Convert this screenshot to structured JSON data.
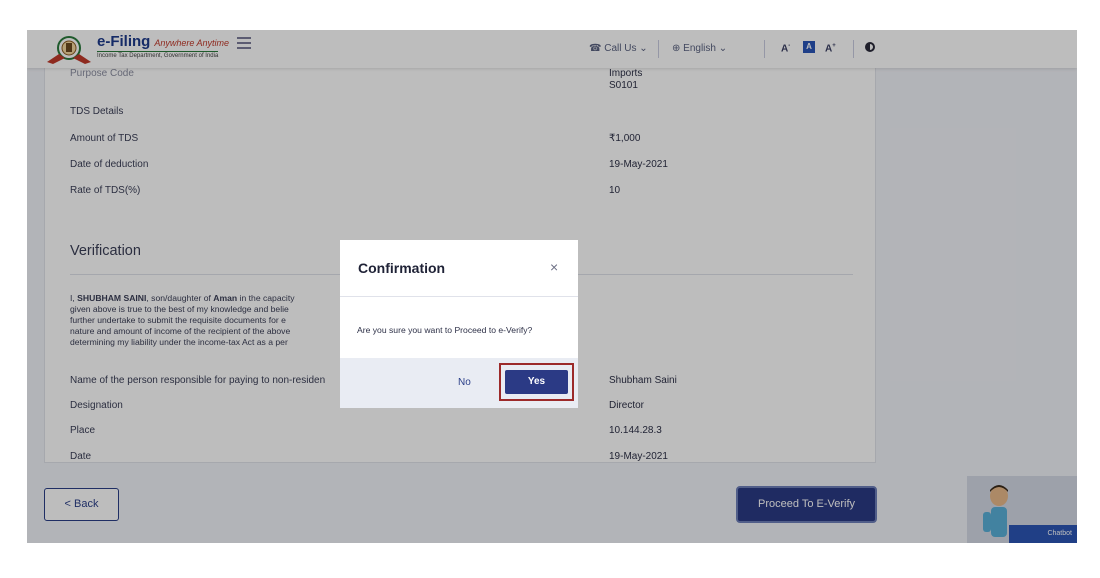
{
  "header": {
    "logo_title": "e-Filing",
    "logo_tagline": "Anywhere Anytime",
    "logo_dept": "Income Tax Department, Government of India",
    "call_us": "Call Us",
    "language": "English",
    "font_decrease": "A",
    "font_normal": "A",
    "font_increase": "A"
  },
  "details": {
    "partial_label": "Purpose Code",
    "partial_value_top": "Imports",
    "partial_value": "S0101",
    "tds_heading": "TDS Details",
    "rows": [
      {
        "label": "Amount of TDS",
        "value": "₹1,000"
      },
      {
        "label": "Date of deduction",
        "value": "19-May-2021"
      },
      {
        "label": "Rate of TDS(%)",
        "value": "10"
      }
    ]
  },
  "verification": {
    "title": "Verification",
    "para_prefix": "I, ",
    "name": "SHUBHAM SAINI",
    "para_mid": ", son/daughter of ",
    "parent": "Aman",
    "para_rest": " in the capacity",
    "lines": [
      "given above is true to the best of my knowledge and belie",
      "further undertake to submit the requisite documents for e",
      "nature and amount of income of the recipient of the above",
      "determining my liability under the income-tax Act as a per"
    ],
    "rows": [
      {
        "label": "Name of the person responsible for paying to non-residen",
        "value": "Shubham Saini"
      },
      {
        "label": "Designation",
        "value": "Director"
      },
      {
        "label": "Place",
        "value": "10.144.28.3"
      },
      {
        "label": "Date",
        "value": "19-May-2021"
      }
    ]
  },
  "footer": {
    "back_label": "< Back",
    "proceed_label": "Proceed To E-Verify",
    "chatbot_label": "Chatbot"
  },
  "modal": {
    "title": "Confirmation",
    "close": "×",
    "message": "Are you sure you want to Proceed to e-Verify?",
    "no_label": "No",
    "yes_label": "Yes"
  }
}
